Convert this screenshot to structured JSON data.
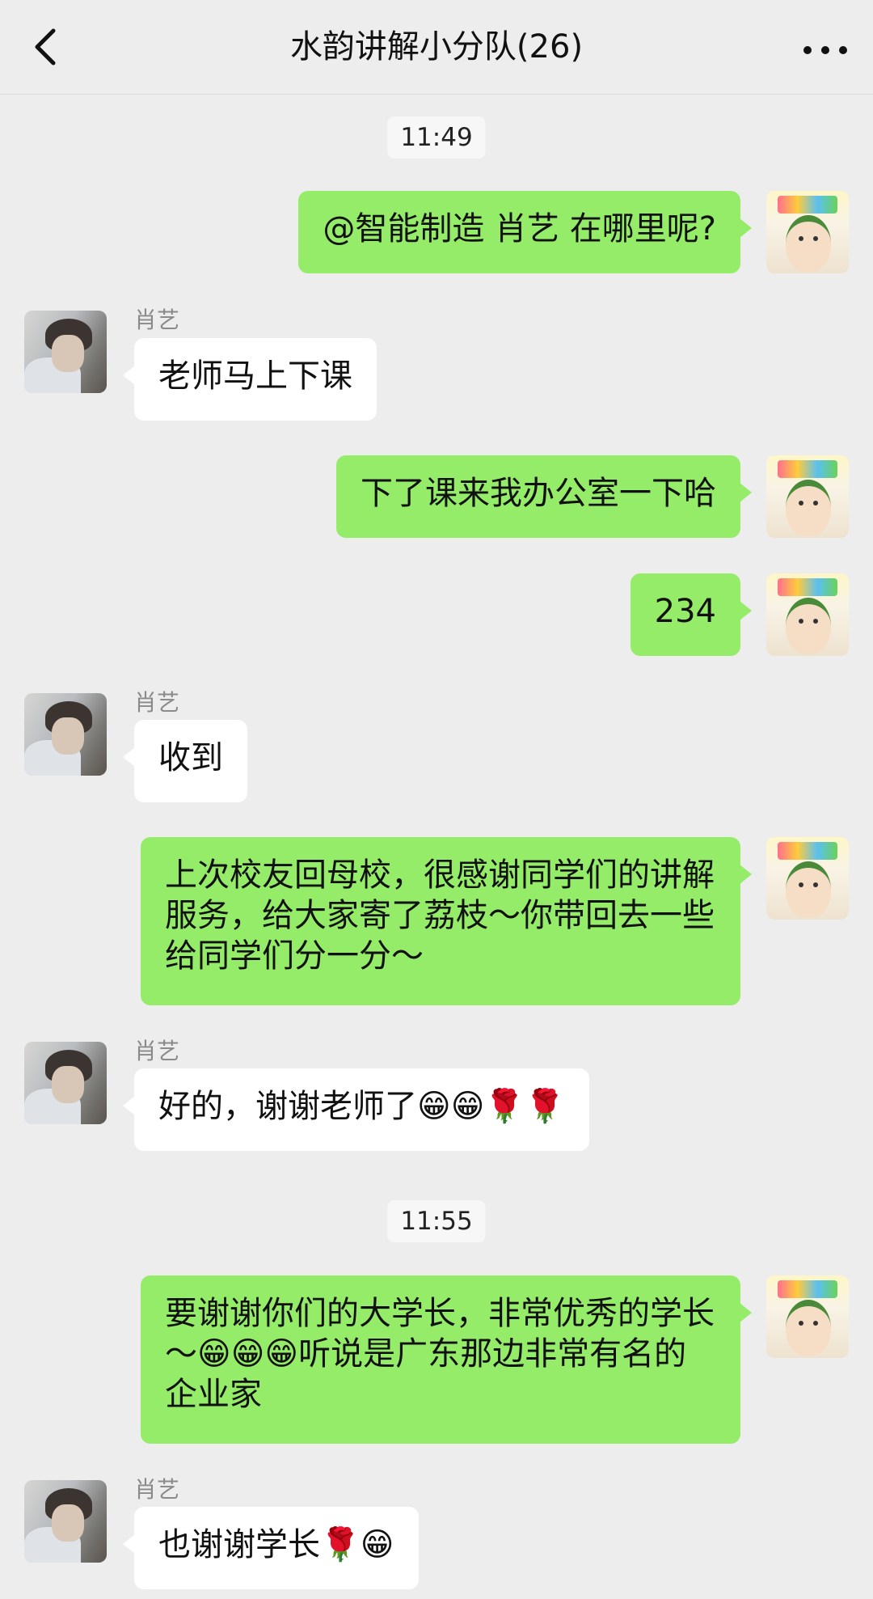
{
  "header": {
    "title": "水韵讲解小分队(26)",
    "back_icon": "chevron-left-icon",
    "more_icon": "more-dots-icon"
  },
  "timestamps": [
    "11:49",
    "11:55"
  ],
  "sender_name": "肖艺",
  "messages": [
    {
      "side": "right",
      "text": "@智能制造 肖艺 在哪里呢?"
    },
    {
      "side": "left",
      "sender": "肖艺",
      "text": "老师马上下课"
    },
    {
      "side": "right",
      "text": "下了课来我办公室一下哈"
    },
    {
      "side": "right",
      "text": "234"
    },
    {
      "side": "left",
      "sender": "肖艺",
      "text": "收到"
    },
    {
      "side": "right",
      "text": "上次校友回母校，很感谢同学们的讲解服务，给大家寄了荔枝～你带回去一些给同学们分一分～"
    },
    {
      "side": "left",
      "sender": "肖艺",
      "text": "好的，谢谢老师了😁😁🌹🌹"
    },
    {
      "side": "right",
      "text": "要谢谢你们的大学长，非常优秀的学长～😁😁😁听说是广东那边非常有名的企业家"
    },
    {
      "side": "left",
      "sender": "肖艺",
      "text": "也谢谢学长🌹😁"
    }
  ],
  "colors": {
    "background": "#ededed",
    "bubble_self": "#95ec69",
    "bubble_other": "#ffffff"
  }
}
